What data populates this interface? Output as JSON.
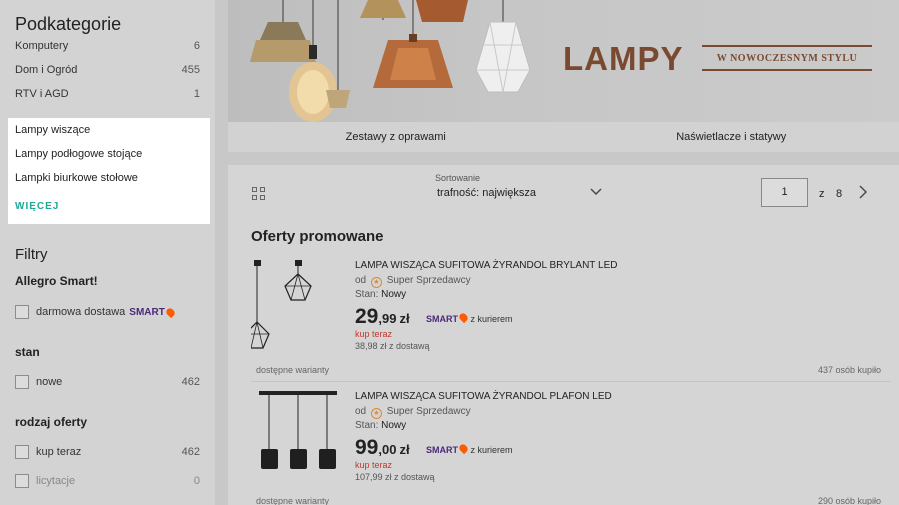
{
  "sidebar": {
    "title": "Podkategorie",
    "categories": [
      {
        "label": "Komputery",
        "count": "6"
      },
      {
        "label": "Dom i Ogród",
        "count": "455"
      },
      {
        "label": "RTV i AGD",
        "count": "1"
      }
    ],
    "subcategories": [
      {
        "label": "Lampy wiszące"
      },
      {
        "label": "Lampy podłogowe stojące"
      },
      {
        "label": "Lampki biurkowe stołowe"
      }
    ],
    "more_label": "WIĘCEJ",
    "filters_title": "Filtry",
    "smart_section": "Allegro Smart!",
    "smart_filter": {
      "label": "darmowa dostawa",
      "badge": "SMART"
    },
    "stan_section": "stan",
    "stan_filter": {
      "label": "nowe",
      "count": "462"
    },
    "offer_type_section": "rodzaj oferty",
    "offer_type_filters": [
      {
        "label": "kup teraz",
        "count": "462"
      },
      {
        "label": "licytacje",
        "count": "0"
      }
    ]
  },
  "banner": {
    "brand": "LAMPY",
    "tagline": "W NOWOCZESNYM STYLU"
  },
  "category_tabs": [
    "Zestawy z oprawami",
    "Naświetlacze i statywy"
  ],
  "listing": {
    "sort_label": "Sortowanie",
    "sort_value": "trafność: największa",
    "page_current": "1",
    "page_of": "z",
    "page_total": "8",
    "promo_title": "Oferty promowane",
    "offers": [
      {
        "name": "LAMPA WISZĄCA SUFITOWA ŻYRANDOL BRYLANT LED",
        "seller_prefix": "od",
        "seller": "Super Sprzedawcy",
        "condition_label": "Stan:",
        "condition": "Nowy",
        "price_main": "29",
        "price_cents": ",99",
        "currency": "zł",
        "smart_badge": "SMART",
        "shipping": "z kurierem",
        "buy_label": "kup teraz",
        "delivery": "38,98 zł z dostawą",
        "variants": "dostępne warianty",
        "bought": "437 osób kupiło"
      },
      {
        "name": "LAMPA WISZĄCA SUFITOWA ŻYRANDOL PLAFON LED",
        "seller_prefix": "od",
        "seller": "Super Sprzedawcy",
        "condition_label": "Stan:",
        "condition": "Nowy",
        "price_main": "99",
        "price_cents": ",00",
        "currency": "zł",
        "smart_badge": "SMART",
        "shipping": "z kurierem",
        "buy_label": "kup teraz",
        "delivery": "107,99 zł z dostawą",
        "variants": "dostępne warianty",
        "bought": "290 osób kupiło"
      }
    ]
  },
  "colors": {
    "accent_teal": "#1fa89a",
    "smart_purple": "#4b2a7a",
    "smart_orange": "#ff5a00",
    "brand_brown": "#7a4a30",
    "buy_red": "#c0392b"
  }
}
